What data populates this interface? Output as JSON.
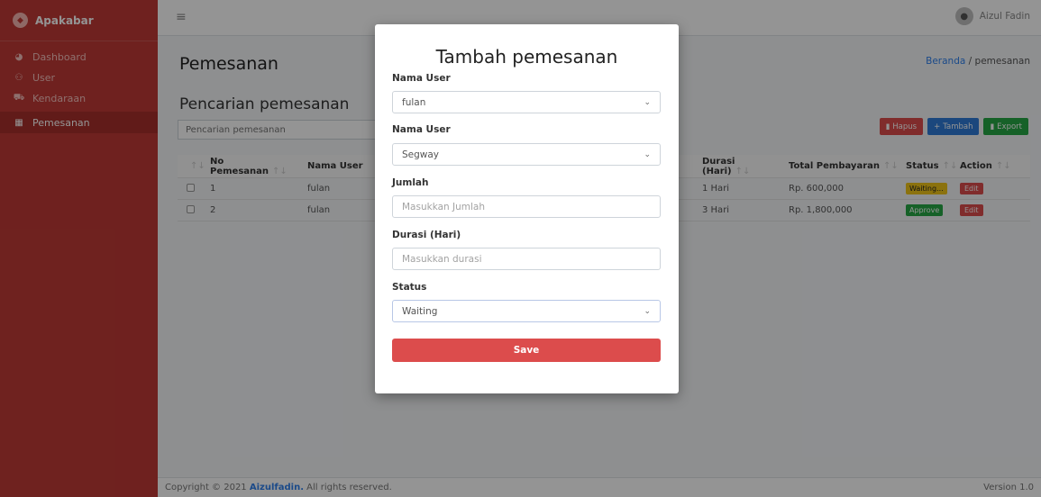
{
  "brand": {
    "name": "Apakabar"
  },
  "sidebar": {
    "items": [
      {
        "label": "Dashboard",
        "icon": "dashboard-icon"
      },
      {
        "label": "User",
        "icon": "users-icon"
      },
      {
        "label": "Kendaraan",
        "icon": "car-icon"
      },
      {
        "label": "Pemesanan",
        "icon": "calendar-icon",
        "active": true
      }
    ]
  },
  "topbar": {
    "user_name": "Aizul Fadin"
  },
  "header": {
    "title": "Pemesanan",
    "breadcrumb_home": "Beranda",
    "breadcrumb_sep": "/",
    "breadcrumb_current": "pemesanan"
  },
  "search": {
    "title": "Pencarian pemesanan",
    "placeholder": "Pencarian pemesanan"
  },
  "actions": {
    "delete_label": "Hapus",
    "add_label": "Tambah",
    "export_label": "Export"
  },
  "table": {
    "columns": [
      "No Pemesanan",
      "Nama User",
      "Durasi (Hari)",
      "Total Pembayaran",
      "Status",
      "Action"
    ],
    "rows": [
      {
        "no": "1",
        "user": "fulan",
        "durasi": "1 Hari",
        "total": "Rp. 600,000",
        "status": "Waiting...",
        "action": "Edit"
      },
      {
        "no": "2",
        "user": "fulan",
        "durasi": "3 Hari",
        "total": "Rp. 1,800,000",
        "status": "Approve",
        "action": "Edit"
      }
    ]
  },
  "footer": {
    "prefix": "Copyright © 2021 ",
    "brand": "Aizulfadin.",
    "suffix": " All rights reserved.",
    "version": "Version 1.0"
  },
  "modal": {
    "title": "Tambah pemesanan",
    "fields": {
      "user1_label": "Nama User",
      "user1_value": "fulan",
      "user2_label": "Nama User",
      "user2_value": "Segway",
      "jumlah_label": "Jumlah",
      "jumlah_placeholder": "Masukkan Jumlah",
      "durasi_label": "Durasi (Hari)",
      "durasi_placeholder": "Masukkan durasi",
      "status_label": "Status",
      "status_value": "Waiting"
    },
    "save_label": "Save"
  },
  "colors": {
    "sidebar": "#c03a36",
    "danger": "#dc4c4c",
    "primary": "#2f7bd8",
    "success": "#27a745",
    "warning": "#f0c419"
  }
}
